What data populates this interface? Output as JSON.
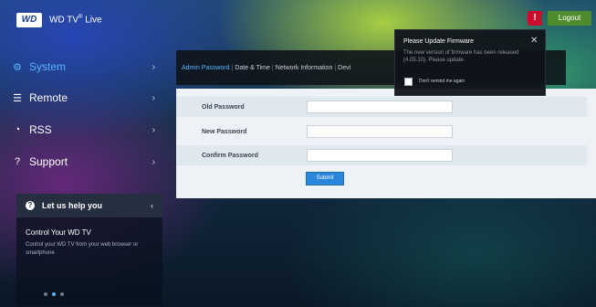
{
  "header": {
    "logo": "WD",
    "title": "WD TV",
    "title_sup": "®",
    "title_suffix": " Live",
    "alert_label": "!",
    "logout_label": "Logout"
  },
  "sidebar": {
    "items": [
      {
        "label": "System",
        "icon": "gear-icon",
        "glyph": "⚙",
        "active": true
      },
      {
        "label": "Remote",
        "icon": "list-icon",
        "glyph": "☰",
        "active": false
      },
      {
        "label": "RSS",
        "icon": "rss-icon",
        "glyph": "◔",
        "active": false
      },
      {
        "label": "Support",
        "icon": "question-icon",
        "glyph": "?",
        "active": false
      }
    ],
    "chevron": "›"
  },
  "help": {
    "header": "Let us help you",
    "icon_glyph": "?",
    "chevron": "‹",
    "title": "Control Your WD TV",
    "body": "Control your WD TV from your web browser or smartphone",
    "dots": 3,
    "active_dot": 1
  },
  "tabs": [
    "Admin Password",
    "Date & Time",
    "Network Information",
    "Devi"
  ],
  "form": {
    "fields": [
      {
        "label": "Old Password",
        "value": ""
      },
      {
        "label": "New Password",
        "value": ""
      },
      {
        "label": "Confirm Password",
        "value": ""
      }
    ],
    "submit_label": "Submit"
  },
  "notification": {
    "title": "Please Update Firmware",
    "close": "✕",
    "body": "The new version of firmware has been released (4.05.10). Please update.",
    "checkbox_label": "Don't remind me again"
  },
  "colors": {
    "accent": "#5ab4ff",
    "alert": "#c8102e",
    "logout": "#4e8c2e",
    "submit": "#2a86d8"
  }
}
